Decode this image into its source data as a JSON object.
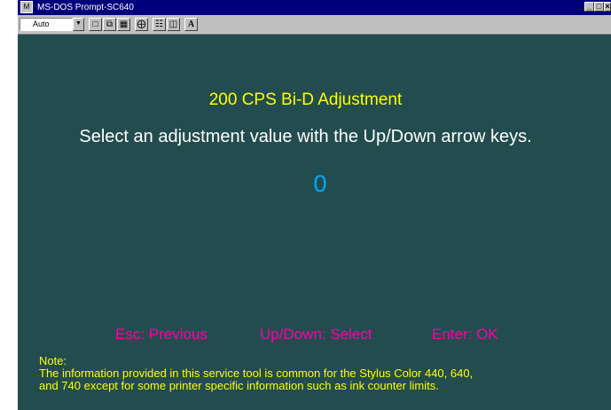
{
  "window": {
    "title": "MS-DOS Prompt-SC640",
    "minimize": "_",
    "maximize": "□",
    "close": "×"
  },
  "toolbar": {
    "font_size": "Auto",
    "font_button": "A"
  },
  "screen": {
    "heading": "200 CPS Bi-D Adjustment",
    "instruction": "Select an adjustment value with the Up/Down arrow keys.",
    "value": "0",
    "keys": {
      "esc": "Esc: Previous",
      "updown": "Up/Down: Select",
      "enter": "Enter: OK"
    },
    "note_label": "Note:",
    "note_line1": "The information provided in this service tool is common for the Stylus Color 440, 640,",
    "note_line2": "and 740 except for some printer specific information such as ink counter limits."
  },
  "colors": {
    "background": "#234c4e",
    "heading": "#ffff00",
    "value": "#00aaff",
    "keys": "#ff00aa",
    "titlebar": "#00007b"
  }
}
